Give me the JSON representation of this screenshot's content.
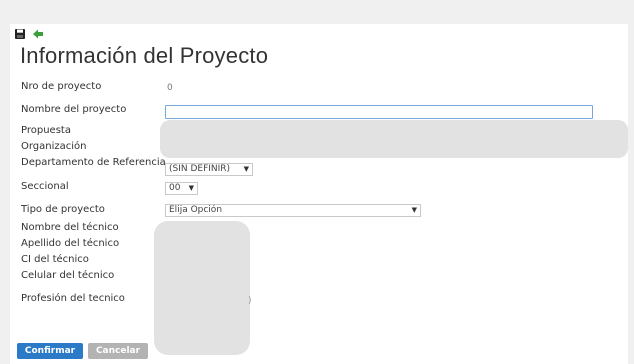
{
  "toolbar": {
    "save_icon": "floppy-disk-icon",
    "back_icon": "green-arrow-left-icon"
  },
  "page": {
    "title": "Información del Proyecto"
  },
  "form": {
    "nro_label": "Nro de proyecto",
    "nro_value": "0",
    "nombre_label": "Nombre del proyecto",
    "nombre_value": "",
    "propuesta_label": "Propuesta",
    "organizacion_label": "Organización",
    "departamento_label": "Departamento de Referencia",
    "departamento_value": "(SIN DEFINIR)",
    "seccional_label": "Seccional",
    "seccional_value": "00",
    "tipo_label": "Tipo de proyecto",
    "tipo_value": "Elija Opción",
    "nombre_tecnico_label": "Nombre del técnico",
    "apellido_tecnico_label": "Apellido del técnico",
    "ci_tecnico_label": "CI del técnico",
    "celular_tecnico_label": "Celular del técnico",
    "profesion_label": "Profesión del tecnico",
    "stray_char": ")"
  },
  "buttons": {
    "confirm": "Confirmar",
    "cancel": "Cancelar"
  },
  "colors": {
    "primary_button": "#2a7ac8",
    "secondary_button": "#b3b3b3",
    "input_focus_border": "#7aa7d9",
    "back_arrow": "#3aa03a"
  }
}
